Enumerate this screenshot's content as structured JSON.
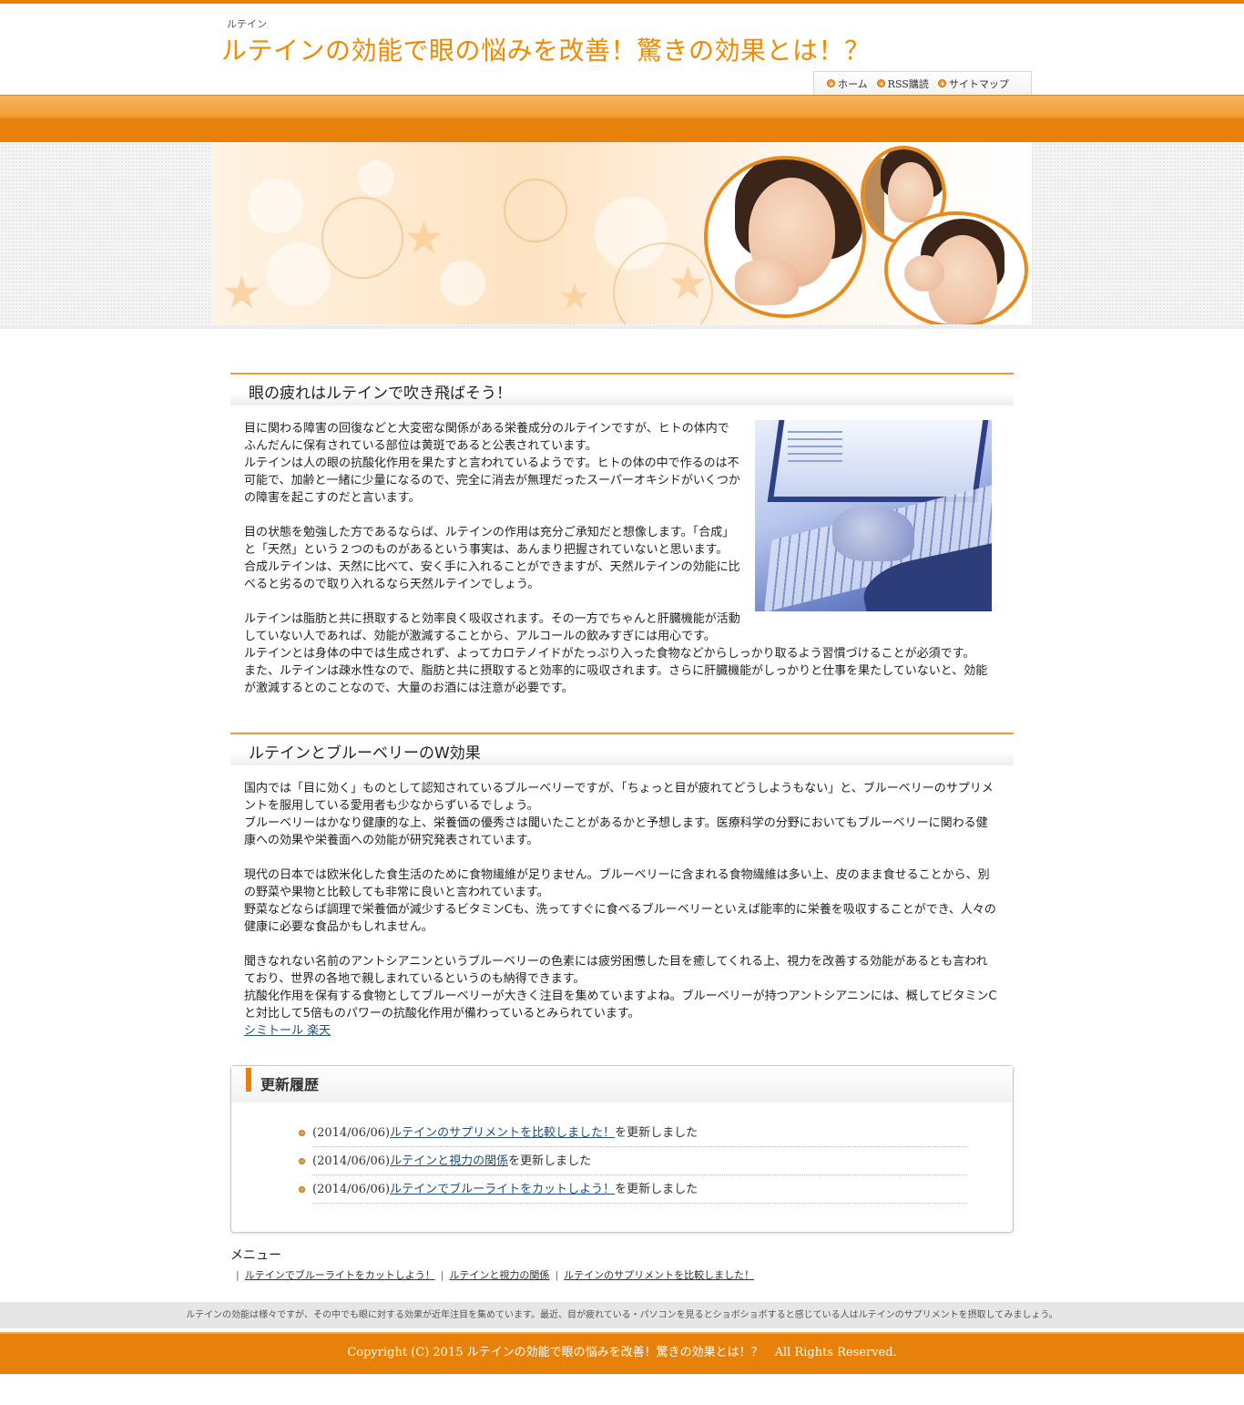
{
  "header": {
    "subtitle": "ルテイン",
    "title": "ルテインの効能で眼の悩みを改善！驚きの効果とは！？"
  },
  "topnav": {
    "items": [
      {
        "label": "ホーム"
      },
      {
        "label": "RSS購読"
      },
      {
        "label": "サイトマップ"
      }
    ]
  },
  "colors": {
    "accent": "#e8810a",
    "title": "#f08a00",
    "link": "#1f4f85"
  },
  "sections": [
    {
      "heading": "眼の疲れはルテインで吹き飛ばそう！",
      "paragraphs": [
        "目に関わる障害の回復などと大変密な関係がある栄養成分のルテインですが、ヒトの体内でふんだんに保有されている部位は黄斑であると公表されています。\nルテインは人の眼の抗酸化作用を果たすと言われているようです。ヒトの体の中で作るのは不可能で、加齢と一緒に少量になるので、完全に消去が無理だったスーパーオキシドがいくつかの障害を起こすのだと言います。",
        "目の状態を勉強した方であるならば、ルテインの作用は充分ご承知だと想像します。「合成」と「天然」という２つのものがあるという事実は、あんまり把握されていないと思います。\n合成ルテインは、天然に比べて、安く手に入れることができますが、天然ルテインの効能に比べると劣るので取り入れるなら天然ルテインでしょう。",
        "ルテインは脂肪と共に摂取すると効率良く吸収されます。その一方でちゃんと肝臓機能が活動していない人であれば、効能が激減することから、アルコールの飲みすぎには用心です。\nルテインとは身体の中では生成されず、よってカロテノイドがたっぷり入った食物などからしっかり取るよう習慣づけることが必須です。\nまた、ルテインは疎水性なので、脂肪と共に摂取すると効率的に吸収されます。さらに肝臓機能がしっかりと仕事を果たしていないと、効能が激減するとのことなので、大量のお酒には注意が必要です。"
      ]
    },
    {
      "heading": "ルテインとブルーベリーのW効果",
      "paragraphs": [
        "国内では「目に効く」ものとして認知されているブルーベリーですが、「ちょっと目が疲れてどうしようもない」と、ブルーベリーのサプリメントを服用している愛用者も少なからずいるでしょう。\nブルーベリーはかなり健康的な上、栄養価の優秀さは聞いたことがあるかと予想します。医療科学の分野においてもブルーベリーに関わる健康への効果や栄養面への効能が研究発表されています。",
        "現代の日本では欧米化した食生活のために食物繊維が足りません。ブルーベリーに含まれる食物繊維は多い上、皮のまま食せることから、別の野菜や果物と比較しても非常に良いと言われています。\n野菜などならば調理で栄養価が減少するビタミンCも、洗ってすぐに食べるブルーベリーといえば能率的に栄養を吸収することができ、人々の健康に必要な食品かもしれません。",
        "聞きなれない名前のアントシアニンというブルーベリーの色素には疲労困憊した目を癒してくれる上、視力を改善する効能があるとも言われており、世界の各地で親しまれているというのも納得できます。\n抗酸化作用を保有する食物としてブルーベリーが大きく注目を集めていますよね。ブルーベリーが持つアントシアニンには、概してビタミンCと対比して5倍ものパワーの抗酸化作用が備わっているとみられています。"
      ],
      "link": "シミトール 楽天"
    }
  ],
  "history": {
    "title": "更新履歴",
    "items": [
      {
        "date": "(2014/06/06)",
        "link": "ルテインのサプリメントを比較しました！",
        "suffix": "を更新しました"
      },
      {
        "date": "(2014/06/06)",
        "link": "ルテインと視力の関係",
        "suffix": "を更新しました"
      },
      {
        "date": "(2014/06/06)",
        "link": "ルテインでブルーライトをカットしよう！",
        "suffix": "を更新しました"
      }
    ]
  },
  "menu": {
    "title": "メニュー",
    "links": [
      "ルテインでブルーライトをカットしよう！",
      "ルテインと視力の関係",
      "ルテインのサプリメントを比較しました！"
    ]
  },
  "footer": {
    "note": "ルテインの効能は様々ですが、その中でも眼に対する効果が近年注目を集めています。最近、目が疲れている・パソコンを見るとショボショボすると感じている人はルテインのサプリメントを摂取してみましょう。",
    "copyright": "Copyright (C) 2015 ルテインの効能で眼の悩みを改善！驚きの効果とは！？　All Rights Reserved."
  }
}
